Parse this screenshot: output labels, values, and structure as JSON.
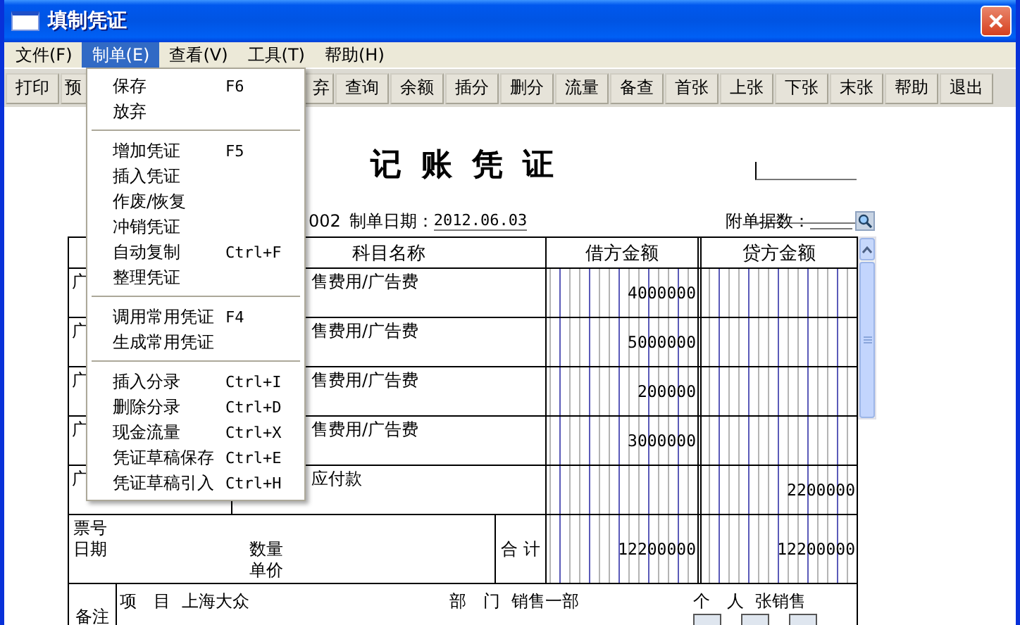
{
  "window": {
    "title": "填制凭证"
  },
  "menu_bar": [
    {
      "label": "文件(F)",
      "selected": false
    },
    {
      "label": "制单(E)",
      "selected": true
    },
    {
      "label": "查看(V)",
      "selected": false
    },
    {
      "label": "工具(T)",
      "selected": false
    },
    {
      "label": "帮助(H)",
      "selected": false
    }
  ],
  "toolbar": [
    {
      "label": "打印",
      "kind": "button"
    },
    {
      "label": "预",
      "kind": "cut_right"
    },
    {
      "label": "弃",
      "kind": "cut_left"
    },
    {
      "label": "查询",
      "kind": "button"
    },
    {
      "label": "余额",
      "kind": "button"
    },
    {
      "label": "插分",
      "kind": "button"
    },
    {
      "label": "删分",
      "kind": "button"
    },
    {
      "label": "流量",
      "kind": "button"
    },
    {
      "label": "备查",
      "kind": "button"
    },
    {
      "label": "首张",
      "kind": "button"
    },
    {
      "label": "上张",
      "kind": "button"
    },
    {
      "label": "下张",
      "kind": "button"
    },
    {
      "label": "末张",
      "kind": "button"
    },
    {
      "label": "帮助",
      "kind": "button"
    },
    {
      "label": "退出",
      "kind": "button"
    }
  ],
  "open_menu": {
    "items": [
      {
        "kind": "item",
        "label": "保存",
        "shortcut": "F6"
      },
      {
        "kind": "item",
        "label": "放弃"
      },
      {
        "kind": "separator"
      },
      {
        "kind": "item",
        "label": "增加凭证",
        "shortcut": "F5"
      },
      {
        "kind": "item",
        "label": "插入凭证"
      },
      {
        "kind": "item",
        "label": "作废/恢复"
      },
      {
        "kind": "item",
        "label": "冲销凭证"
      },
      {
        "kind": "item",
        "label": "自动复制",
        "shortcut": "Ctrl+F"
      },
      {
        "kind": "item",
        "label": "整理凭证"
      },
      {
        "kind": "separator"
      },
      {
        "kind": "item",
        "label": "调用常用凭证",
        "shortcut": "F4"
      },
      {
        "kind": "item",
        "label": "生成常用凭证"
      },
      {
        "kind": "separator"
      },
      {
        "kind": "item",
        "label": "插入分录",
        "shortcut": "Ctrl+I"
      },
      {
        "kind": "item",
        "label": "删除分录",
        "shortcut": "Ctrl+D"
      },
      {
        "kind": "item",
        "label": "现金流量",
        "shortcut": "Ctrl+X"
      },
      {
        "kind": "item",
        "label": "凭证草稿保存",
        "shortcut": "Ctrl+E"
      },
      {
        "kind": "item",
        "label": "凭证草稿引入",
        "shortcut": "Ctrl+H"
      }
    ]
  },
  "voucher": {
    "title": "记账凭证",
    "number": "002",
    "date_label": "制单日期：",
    "date": "2012.06.03",
    "attachments_label": "附单据数：",
    "columns": [
      "科目名称",
      "借方金额",
      "贷方金额"
    ],
    "rows": [
      {
        "summary": "广",
        "account": "售费用/广告费",
        "debit": "4000000"
      },
      {
        "summary": "广",
        "account": "售费用/广告费",
        "debit": "5000000"
      },
      {
        "summary": "广",
        "account": "售费用/广告费",
        "debit": "200000"
      },
      {
        "summary": "广",
        "account": "售费用/广告费",
        "debit": "3000000"
      },
      {
        "summary": "广",
        "account": "应付款",
        "credit": "2200000"
      }
    ],
    "footer": {
      "ticket_label": "票号",
      "date_label": "日期",
      "quantity_label": "数量",
      "price_label": "单价",
      "total_label": "合 计",
      "debit_total": "12200000",
      "credit_total": "12200000"
    },
    "remarks": {
      "label": "备注",
      "fields": [
        {
          "label": "项　目",
          "value": "上海大众"
        },
        {
          "label": "部　门",
          "value": "销售一部"
        },
        {
          "label": "个　人",
          "value": "张销售"
        }
      ]
    }
  }
}
